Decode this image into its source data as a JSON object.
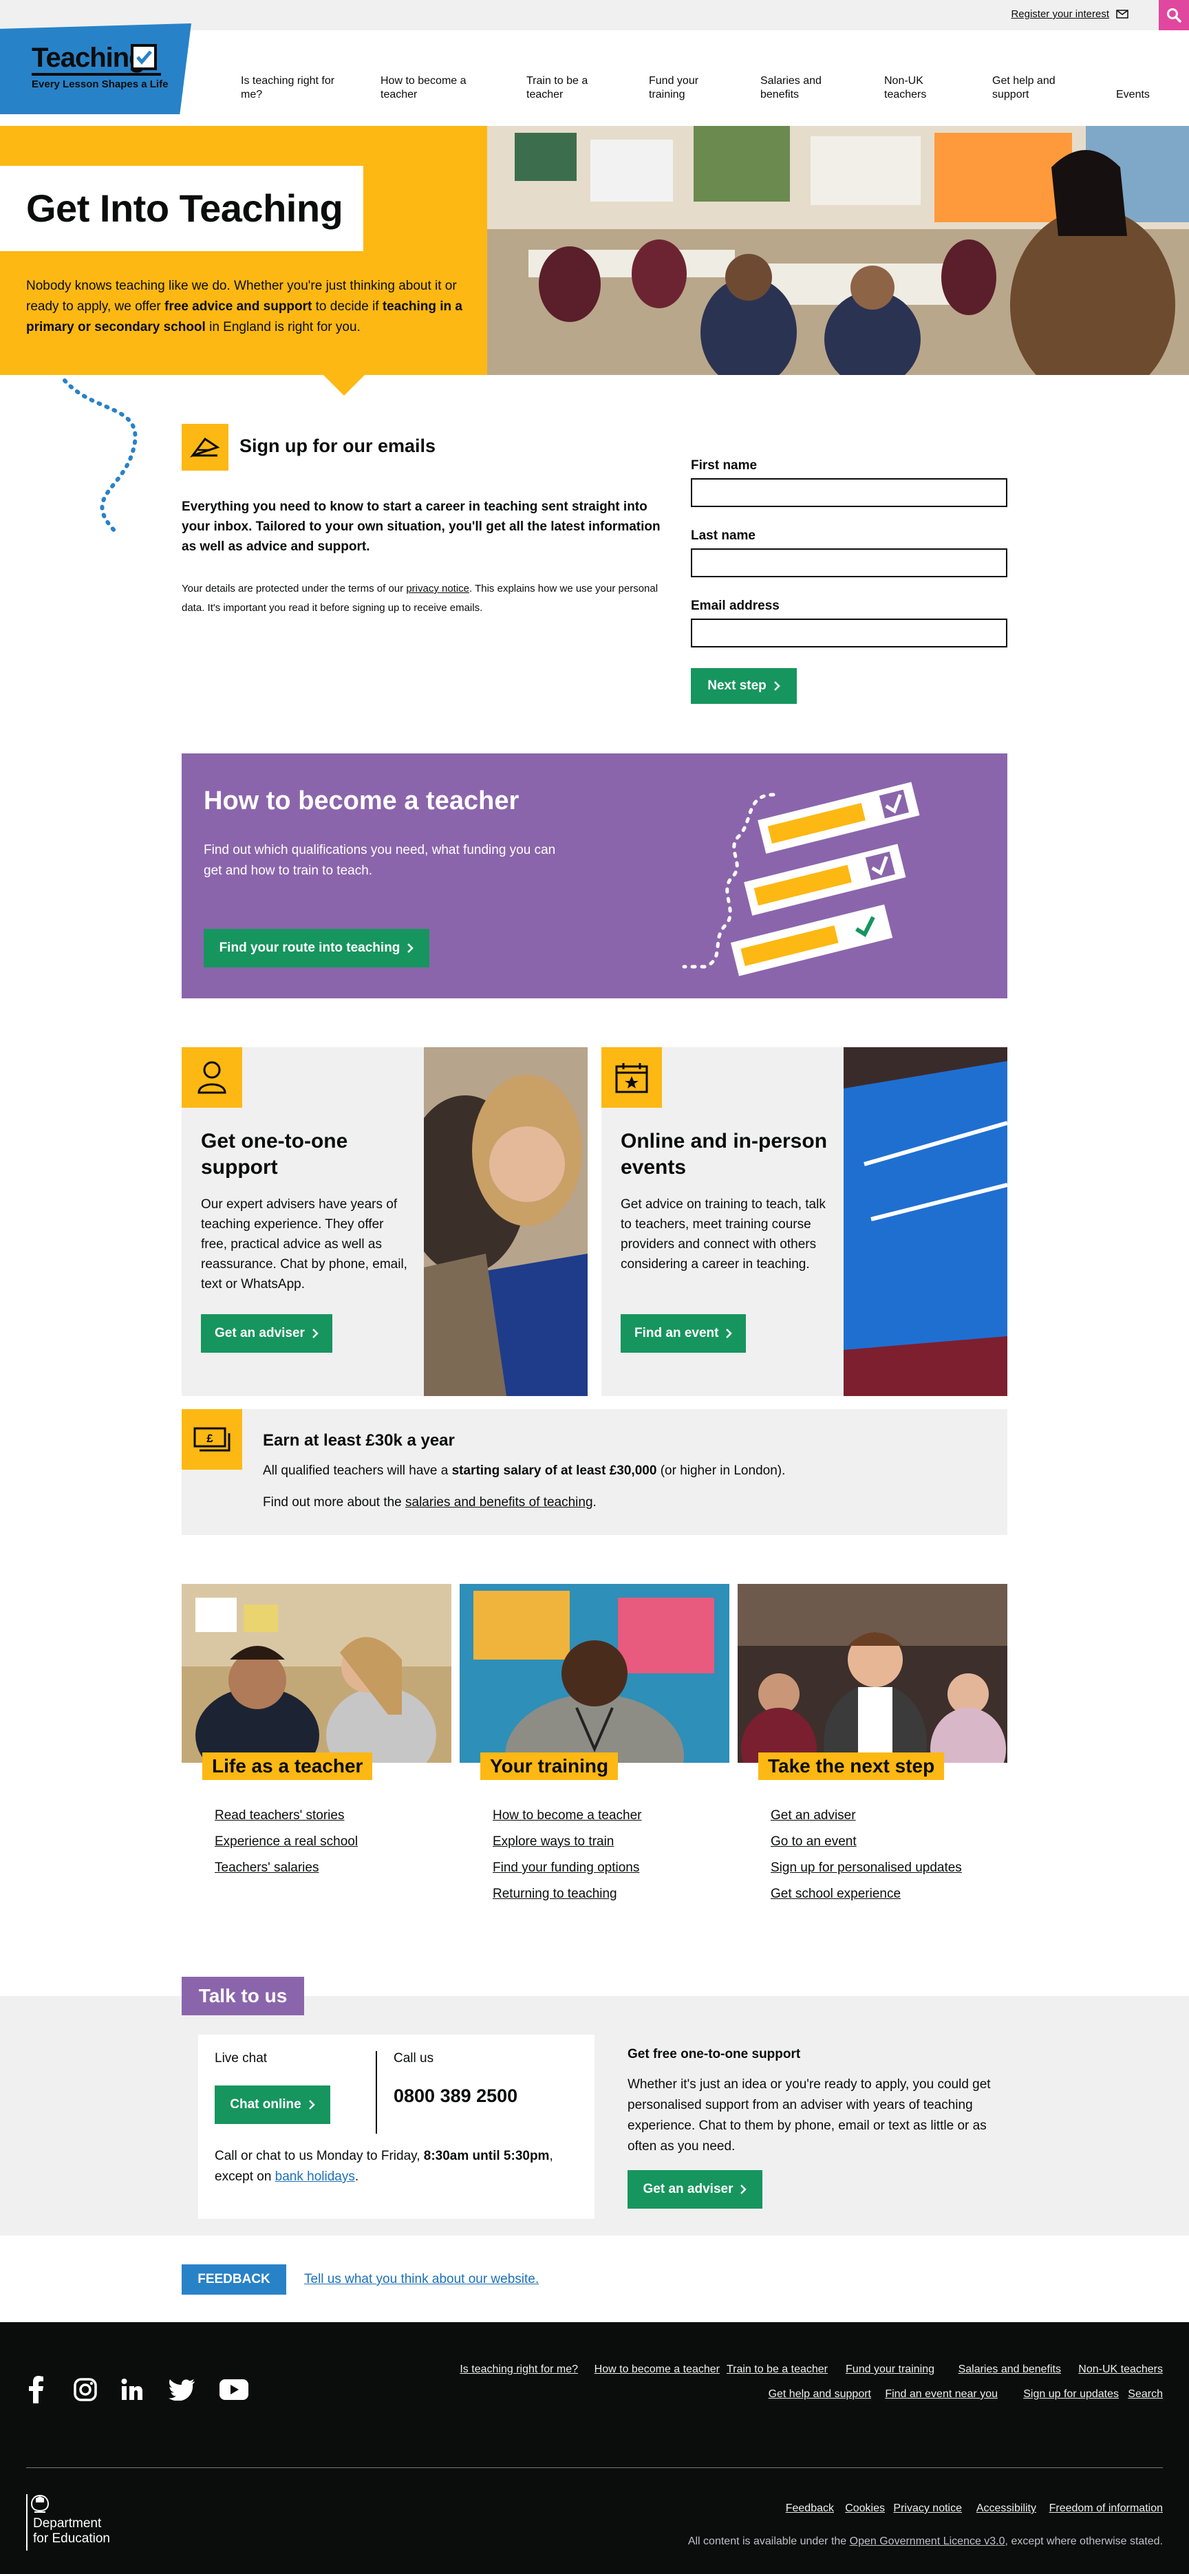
{
  "header": {
    "register_label": "Register your interest",
    "logo_title": "Teaching",
    "logo_tagline": "Every Lesson Shapes a Life",
    "nav": [
      {
        "line1": "Is teaching right for",
        "line2": "me?"
      },
      {
        "line1": "How to become a",
        "line2": "teacher"
      },
      {
        "line1": "Train to be a",
        "line2": "teacher"
      },
      {
        "line1": "Fund your",
        "line2": "training"
      },
      {
        "line1": "Salaries and",
        "line2": "benefits"
      },
      {
        "line1": "Non-UK",
        "line2": "teachers"
      },
      {
        "line1": "Get help and",
        "line2": "support"
      },
      {
        "line1": "",
        "line2": "Events"
      }
    ]
  },
  "hero": {
    "title": "Get Into Teaching",
    "text_part1": "Nobody knows teaching like we do. Whether you're just thinking about it or ready to apply, we offer ",
    "text_bold1": "free advice and support",
    "text_part2": " to decide if ",
    "text_bold2": "teaching in a primary or secondary school",
    "text_part3": " in England is right for you."
  },
  "signup": {
    "heading": "Sign up for our emails",
    "lead": "Everything you need to know to start a career in teaching sent straight into your inbox. Tailored to your own situation, you'll get all the latest information as well as advice and support.",
    "privacy_pre": "Your details are protected under the terms of our ",
    "privacy_link": "privacy notice",
    "privacy_post": ". This explains how we use your personal data. It's important you read it before signing up to receive emails.",
    "first_name_label": "First name",
    "last_name_label": "Last name",
    "email_label": "Email address",
    "next_label": "Next step"
  },
  "become": {
    "title": "How to become a teacher",
    "text": "Find out which qualifications you need, what funding you can get and how to train to teach.",
    "button": "Find your route into teaching"
  },
  "cards": [
    {
      "title": "Get one-to-one support",
      "text": "Our expert advisers have years of teaching experience. They offer free, practical advice as well as reassurance. Chat by phone, email, text or WhatsApp.",
      "button": "Get an adviser"
    },
    {
      "title": "Online and in-person events",
      "text": "Get advice on training to teach, talk to teachers, meet training course providers and connect with others considering a career in teaching.",
      "button": "Find an event"
    }
  ],
  "earn": {
    "title": "Earn at least £30k a year",
    "line1_pre": "All qualified teachers will have a ",
    "line1_bold": "starting salary of at least £30,000",
    "line1_post": " (or higher in London).",
    "line2_pre": "Find out more about the ",
    "line2_link": "salaries and benefits of teaching",
    "line2_post": "."
  },
  "columns": [
    {
      "title": "Life as a teacher",
      "links": [
        "Read teachers' stories",
        "Experience a real school",
        "Teachers' salaries"
      ]
    },
    {
      "title": "Your training",
      "links": [
        "How to become a teacher",
        "Explore ways to train",
        "Find your funding options",
        "Returning to teaching"
      ]
    },
    {
      "title": "Take the next step",
      "links": [
        "Get an adviser",
        "Go to an event",
        "Sign up for personalised updates",
        "Get school experience"
      ]
    }
  ],
  "talk": {
    "tag": "Talk to us",
    "live_chat": "Live chat",
    "chat_button": "Chat online",
    "call_us": "Call us",
    "phone": "0800 389 2500",
    "hours_pre": "Call or chat to us Monday to Friday, ",
    "hours_bold": "8:30am until 5:30pm",
    "hours_mid": ", except on ",
    "hours_link": "bank holidays",
    "hours_post": ".",
    "free_heading": "Get free one-to-one support",
    "free_text": "Whether it's just an idea or you're ready to apply, you could get personalised support from an adviser with years of teaching experience. Chat to them by phone, email or text as little or as often as you need.",
    "adviser_button": "Get an adviser"
  },
  "feedback": {
    "button": "FEEDBACK",
    "link": "Tell us what you think about our website."
  },
  "footer": {
    "social": [
      "facebook-icon",
      "instagram-icon",
      "linkedin-icon",
      "twitter-icon",
      "youtube-icon"
    ],
    "links_row1": [
      "Is teaching right for me?",
      "How to become a teacher",
      "Train to be a teacher",
      "Fund your training",
      "Salaries and benefits",
      "Non-UK teachers"
    ],
    "links_row2": [
      "Get help and support",
      "Find an event near you",
      "Sign up for updates",
      "Search"
    ],
    "links_row3": [
      "Feedback",
      "Cookies",
      "Privacy notice",
      "Accessibility",
      "Freedom of information"
    ],
    "dfe_line1": "Department",
    "dfe_line2": "for Education",
    "licence_pre": "All content is available under the ",
    "licence_link": "Open Government Licence v3.0",
    "licence_post": ", except where otherwise stated."
  },
  "colors": {
    "yellow": "#fdb813",
    "purple": "#8b65ab",
    "green": "#17955e",
    "blue": "#2882c8",
    "pink": "#e0479e",
    "footer": "#0b0c0c"
  }
}
